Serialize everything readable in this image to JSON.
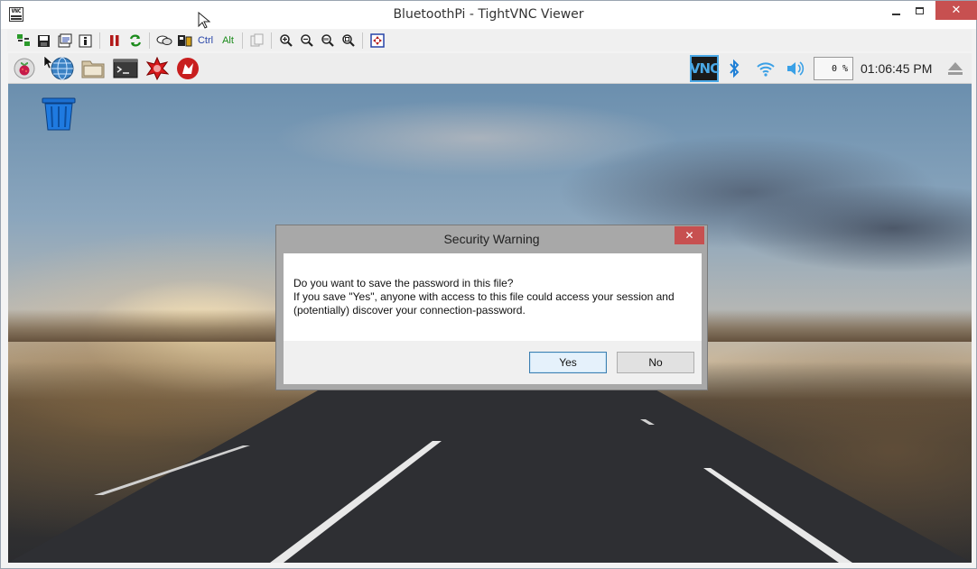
{
  "window": {
    "title": "BluetoothPi - TightVNC Viewer",
    "app_icon_text": "VNC",
    "close_glyph": "✕"
  },
  "vnc_toolbar": {
    "ctrl_label": "Ctrl",
    "alt_label": "Alt",
    "icons": [
      "new-connection-icon",
      "save-icon",
      "options-icon",
      "info-icon",
      "pause-icon",
      "refresh-icon",
      "chat-icon",
      "transfer-icon",
      "ctrl-key",
      "alt-key",
      "copy-icon",
      "zoom-in-icon",
      "zoom-out-icon",
      "zoom-100-icon",
      "zoom-fit-icon",
      "fullscreen-icon"
    ]
  },
  "pi_panel": {
    "launchers": [
      "raspberry-menu-icon",
      "web-browser-icon",
      "file-manager-icon",
      "terminal-icon",
      "mathematica-icon",
      "wolfram-icon"
    ],
    "vnc_tray_text": "VNC",
    "cpu_usage": "0 %",
    "clock": "01:06:45 PM"
  },
  "desktop": {
    "icons": [
      "trash-icon"
    ]
  },
  "dialog": {
    "title": "Security Warning",
    "close_glyph": "✕",
    "line1": "Do you want to save the password in this file?",
    "line2": "If you save \"Yes\", anyone with access to this file could access your session and",
    "line3": "(potentially) discover your connection-password.",
    "yes_label": "Yes",
    "no_label": "No"
  },
  "colors": {
    "dialog_close": "#c75050",
    "vnc_tray_accent": "#4aa8e6",
    "primary_button_border": "#3c7fb1"
  }
}
